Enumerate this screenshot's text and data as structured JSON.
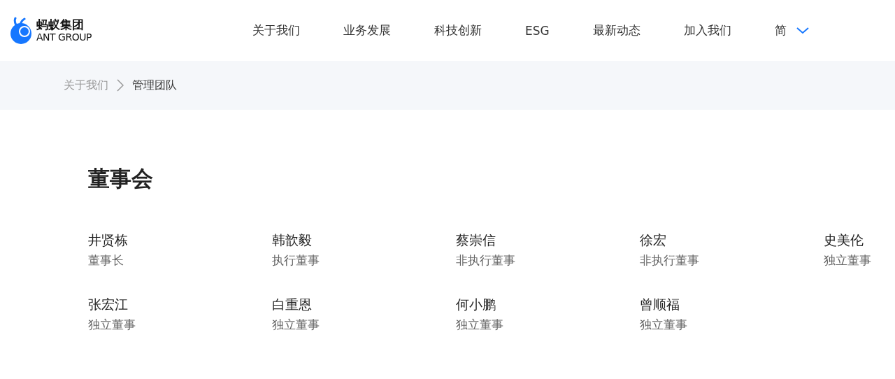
{
  "logo": {
    "name_cn": "蚂蚁集团",
    "name_en": "ANT GROUP"
  },
  "nav": [
    {
      "label": "关于我们"
    },
    {
      "label": "业务发展"
    },
    {
      "label": "科技创新"
    },
    {
      "label": "ESG"
    },
    {
      "label": "最新动态"
    },
    {
      "label": "加入我们"
    }
  ],
  "language": {
    "label": "简"
  },
  "breadcrumb": [
    {
      "label": "关于我们",
      "current": false
    },
    {
      "label": "管理团队",
      "current": true
    }
  ],
  "section_title": "董事会",
  "members": [
    {
      "name": "井贤栋",
      "role": "董事长"
    },
    {
      "name": "韩歆毅",
      "role": "执行董事"
    },
    {
      "name": "蔡崇信",
      "role": "非执行董事"
    },
    {
      "name": "徐宏",
      "role": "非执行董事"
    },
    {
      "name": "史美伦",
      "role": "独立董事"
    },
    {
      "name": "张宏江",
      "role": "独立董事"
    },
    {
      "name": "白重恩",
      "role": "独立董事"
    },
    {
      "name": "何小鹏",
      "role": "独立董事"
    },
    {
      "name": "曾顺福",
      "role": "独立董事"
    }
  ]
}
